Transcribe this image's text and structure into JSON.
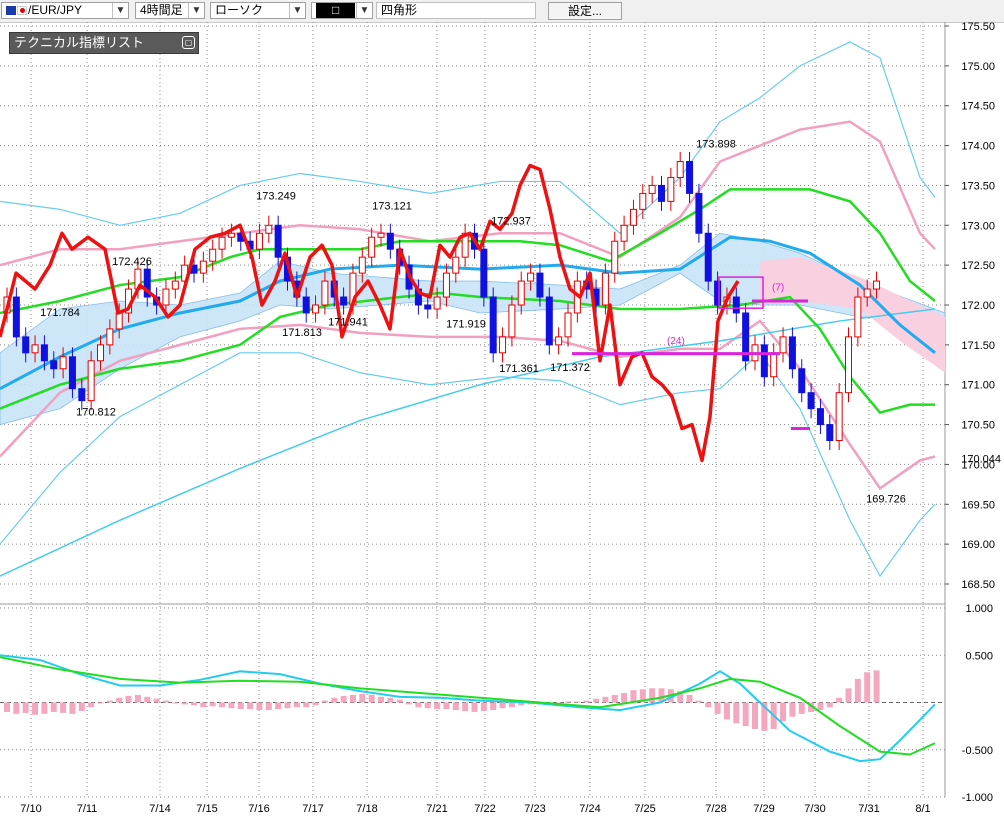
{
  "toolbar": {
    "symbol": "EUR/JPY",
    "timeframe": "4時間足",
    "chart_type": "ローソク",
    "tool_shape": "□",
    "tool_name": "四角形",
    "settings_label": "設定..."
  },
  "tech_panel": {
    "title": "テクニカル指標リスト"
  },
  "chart_data": {
    "type": "candlestick",
    "symbol": "EUR/JPY",
    "timeframe": "4時間足",
    "y_ticks": [
      "175.50",
      "175.00",
      "174.50",
      "174.00",
      "173.50",
      "173.00",
      "172.50",
      "172.00",
      "171.50",
      "171.00",
      "170.50",
      "170.00",
      "169.50",
      "169.00",
      "168.50"
    ],
    "ylim": [
      168.4,
      175.55
    ],
    "current_price": "170.044",
    "x_ticks": [
      "7/10",
      "7/11",
      "7/14",
      "7/15",
      "7/16",
      "7/17",
      "7/18",
      "7/21",
      "7/22",
      "7/23",
      "7/24",
      "7/25",
      "7/28",
      "7/29",
      "7/30",
      "7/31",
      "8/1"
    ],
    "price_labels": [
      {
        "text": "171.784",
        "date": "7/10",
        "value": 171.784
      },
      {
        "text": "170.812",
        "date": "7/11",
        "value": 170.812
      },
      {
        "text": "172.426",
        "date": "7/11",
        "value": 172.426
      },
      {
        "text": "173.249",
        "date": "7/16",
        "value": 173.249
      },
      {
        "text": "171.813",
        "date": "7/17",
        "value": 171.813
      },
      {
        "text": "171.941",
        "date": "7/18",
        "value": 171.941
      },
      {
        "text": "173.121",
        "date": "7/18",
        "value": 173.121
      },
      {
        "text": "171.919",
        "date": "7/21",
        "value": 171.919
      },
      {
        "text": "172.937",
        "date": "7/22",
        "value": 172.937
      },
      {
        "text": "171.361",
        "date": "7/23",
        "value": 171.361
      },
      {
        "text": "171.372",
        "date": "7/24",
        "value": 171.372
      },
      {
        "text": "173.898",
        "date": "7/28",
        "value": 173.898
      },
      {
        "text": "169.726",
        "date": "7/31",
        "value": 169.726
      }
    ],
    "annotations": [
      "(24)",
      "(7)"
    ],
    "osc_ticks": [
      "1.000",
      "0.500",
      "-0.500",
      "-1.000"
    ],
    "osc_ylim": [
      -1.0,
      1.0
    ],
    "colors": {
      "bull_candle": "#e00000",
      "bear_candle": "#1010e0",
      "line_red": "#ee1111",
      "ma_green": "#22dd22",
      "ma_blue": "#22aaee",
      "bb_pink": "#f2a0c0",
      "bb_cyan": "#66ccee",
      "cloud_blue": "#c8e4f8",
      "cloud_pink": "#f8d0e0",
      "marker_magenta": "#dd22dd",
      "hist": "#f4a8c0"
    }
  }
}
